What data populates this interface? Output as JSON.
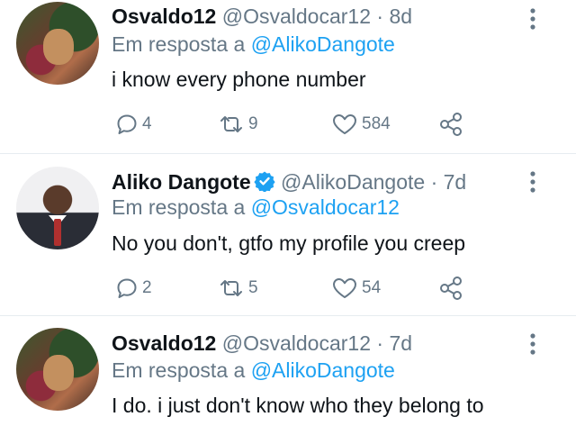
{
  "tweets": [
    {
      "name": "Osvaldo12",
      "handle": "@Osvaldocar12",
      "separator": "·",
      "time": "8d",
      "verified": false,
      "reply_prefix": "Em resposta a",
      "reply_mention": "@AlikoDangote",
      "text": "i know every phone number",
      "replies": "4",
      "retweets": "9",
      "likes": "584"
    },
    {
      "name": "Aliko Dangote",
      "handle": "@AlikoDangote",
      "separator": "·",
      "time": "7d",
      "verified": true,
      "reply_prefix": "Em resposta a",
      "reply_mention": "@Osvaldocar12",
      "text": "No you don't, gtfo my profile you creep",
      "replies": "2",
      "retweets": "5",
      "likes": "54"
    },
    {
      "name": "Osvaldo12",
      "handle": "@Osvaldocar12",
      "separator": "·",
      "time": "7d",
      "verified": false,
      "reply_prefix": "Em resposta a",
      "reply_mention": "@AlikoDangote",
      "text": "I do. i just don't know who they belong to"
    }
  ],
  "icons": {
    "reply": "speech-bubble-icon",
    "retweet": "retweet-icon",
    "like": "heart-icon",
    "share": "share-icon",
    "more": "three-dots-vertical-icon",
    "verified": "verified-badge-icon"
  },
  "colors": {
    "link": "#1da1f2",
    "muted": "#657786",
    "text": "#0f1419",
    "divider": "#e6ecf0",
    "verified": "#1da1f2"
  }
}
